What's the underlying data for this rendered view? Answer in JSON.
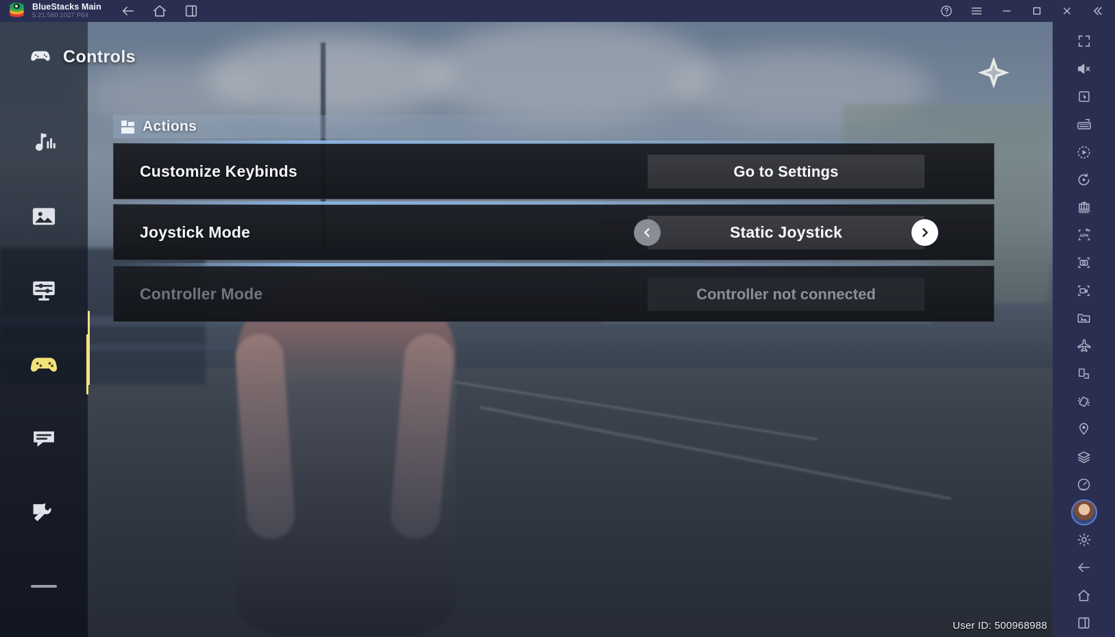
{
  "titlebar": {
    "app_name": "BlueStacks Main",
    "version": "5.21.560.1027  P64",
    "nav_icons": [
      "back-icon",
      "home-icon",
      "multi-window-icon"
    ],
    "window_buttons": [
      "help-icon",
      "menu-icon",
      "minimize-icon",
      "maximize-icon",
      "close-icon",
      "collapse-icon"
    ]
  },
  "game_nav": {
    "items": [
      {
        "name": "audio",
        "icon": "music-note-icon",
        "active": false
      },
      {
        "name": "graphics",
        "icon": "image-icon",
        "active": false
      },
      {
        "name": "display",
        "icon": "display-settings-icon",
        "active": false
      },
      {
        "name": "controls",
        "icon": "gamepad-icon",
        "active": true
      },
      {
        "name": "language",
        "icon": "chat-bubble-icon",
        "active": false
      },
      {
        "name": "other",
        "icon": "wrench-icon",
        "active": false
      },
      {
        "name": "more",
        "icon": "dash-icon",
        "active": false
      }
    ]
  },
  "panel": {
    "title": "Controls",
    "title_icon": "gamepad-icon",
    "close_icon": "star-close-icon",
    "section": {
      "title": "Actions",
      "icon": "blocks-icon"
    },
    "rows": [
      {
        "label": "Customize Keybinds",
        "disabled": false,
        "control": "button",
        "button_label": "Go to Settings"
      },
      {
        "label": "Joystick Mode",
        "disabled": false,
        "control": "stepper",
        "value": "Static Joystick",
        "prev_enabled": false,
        "next_enabled": true
      },
      {
        "label": "Controller Mode",
        "disabled": true,
        "control": "disabled-button",
        "button_label": "Controller not connected"
      }
    ]
  },
  "sidebar": {
    "items": [
      {
        "name": "fullscreen",
        "icon": "fullscreen-icon"
      },
      {
        "name": "mute",
        "icon": "speaker-mute-icon"
      },
      {
        "name": "cursor",
        "icon": "cursor-icon"
      },
      {
        "name": "keyboard-controls",
        "icon": "keyboard-icon"
      },
      {
        "name": "macro",
        "icon": "play-circle-icon"
      },
      {
        "name": "rotate",
        "icon": "rotate-icon"
      },
      {
        "name": "multi-instance",
        "icon": "multi-instance-icon"
      },
      {
        "name": "install-apk",
        "icon": "apk-plus-icon"
      },
      {
        "name": "screenshot",
        "icon": "camera-icon"
      },
      {
        "name": "screen-record",
        "icon": "video-record-icon"
      },
      {
        "name": "media-manager",
        "icon": "media-folder-icon"
      },
      {
        "name": "eco-mode",
        "icon": "airplane-icon"
      },
      {
        "name": "app-tilt",
        "icon": "tilt-icon"
      },
      {
        "name": "shake",
        "icon": "shake-icon"
      },
      {
        "name": "location",
        "icon": "location-pin-icon"
      },
      {
        "name": "layers",
        "icon": "layers-icon"
      },
      {
        "name": "performance",
        "icon": "gauge-icon"
      }
    ],
    "bottom_items": [
      {
        "name": "profile",
        "icon": "avatar-icon"
      },
      {
        "name": "settings",
        "icon": "gear-icon"
      },
      {
        "name": "back",
        "icon": "back-arrow-icon"
      },
      {
        "name": "home",
        "icon": "home-icon"
      },
      {
        "name": "recents",
        "icon": "recents-icon"
      }
    ]
  },
  "status": {
    "user_id": "User ID: 500968988"
  }
}
